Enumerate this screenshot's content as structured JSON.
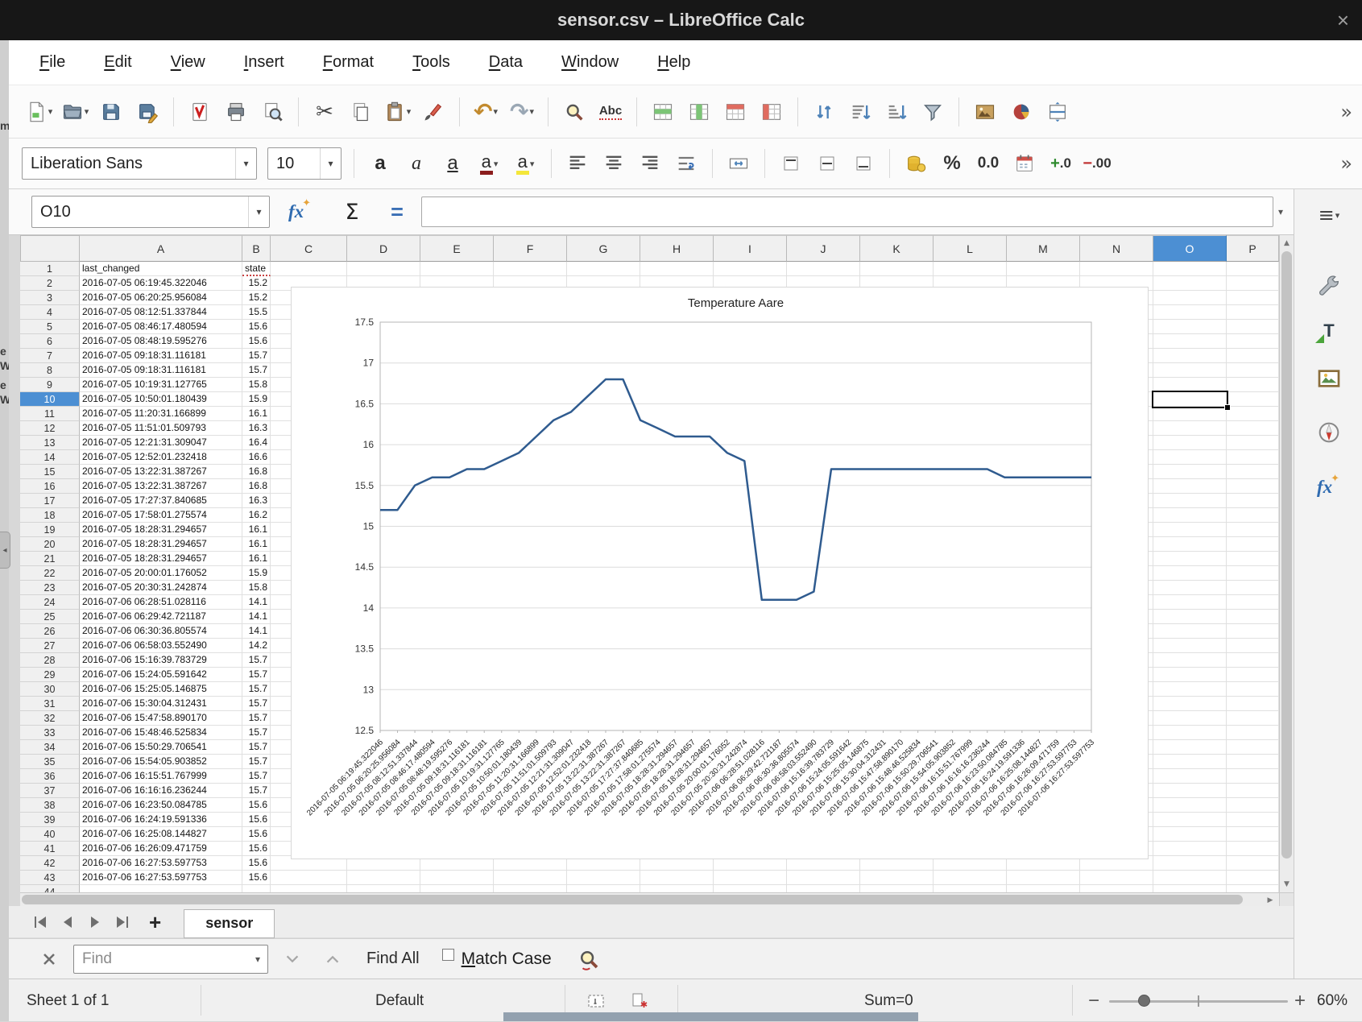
{
  "window": {
    "title": "sensor.csv – LibreOffice Calc",
    "close_glyph": "×"
  },
  "left_edge": {
    "letters": [
      "m",
      "e",
      "W",
      "e",
      "W"
    ]
  },
  "menubar": {
    "items": [
      "File",
      "Edit",
      "View",
      "Insert",
      "Format",
      "Tools",
      "Data",
      "Window",
      "Help"
    ]
  },
  "toolbars": {
    "overflow_glyph": "»",
    "font_name": "Liberation Sans",
    "font_size": "10",
    "standard_icon_names": [
      "new",
      "open",
      "save",
      "save-as",
      "export-pdf",
      "print",
      "print-preview",
      "cut",
      "copy",
      "paste",
      "clone-formatting",
      "undo",
      "redo",
      "find-and-replace",
      "spelling",
      "insert-row",
      "insert-column",
      "delete-row",
      "delete-column",
      "sort",
      "sort-ascending",
      "sort-descending",
      "autofilter",
      "insert-image",
      "insert-chart",
      "split-window"
    ],
    "formatting_icon_names": [
      "bold",
      "italic",
      "underline",
      "font-color",
      "highlighting-color",
      "align-left",
      "align-center",
      "align-right",
      "wrap-text",
      "merge-cells",
      "align-top",
      "center-vertically",
      "align-bottom",
      "currency",
      "percent",
      "number-format",
      "date-format",
      "add-decimal",
      "delete-decimal"
    ]
  },
  "icons": {
    "cut": "✂",
    "undo": "↶",
    "redo": "↷",
    "sum": "Σ",
    "equals": "=",
    "function_wizard": "fx",
    "star": "✦",
    "sidebar_menu": "≡",
    "styles_letter": "T",
    "spelling": "Abc",
    "bold": "a",
    "italic": "a",
    "underline": "a",
    "font_color": "a",
    "highlight": "a",
    "percent": "%",
    "number_format": "0.0",
    "add_decimal_sign": "+",
    "add_decimal_num": ".0",
    "del_decimal_sign": "−",
    "del_decimal_num": ".00",
    "add_sheet": "+"
  },
  "formula_bar": {
    "cell_reference": "O10",
    "input_value": ""
  },
  "grid": {
    "columns": [
      "A",
      "B",
      "C",
      "D",
      "E",
      "F",
      "G",
      "H",
      "I",
      "J",
      "K",
      "L",
      "M",
      "N",
      "O",
      "P"
    ],
    "selected_column": "O",
    "selected_row": 10,
    "selected_cell": "O10",
    "row_count": 44,
    "header_row": {
      "A": "last_changed",
      "B": "state"
    },
    "rows": [
      [
        "last_changed",
        "state"
      ],
      [
        "2016-07-05 06:19:45.322046",
        "15.2"
      ],
      [
        "2016-07-05 06:20:25.956084",
        "15.2"
      ],
      [
        "2016-07-05 08:12:51.337844",
        "15.5"
      ],
      [
        "2016-07-05 08:46:17.480594",
        "15.6"
      ],
      [
        "2016-07-05 08:48:19.595276",
        "15.6"
      ],
      [
        "2016-07-05 09:18:31.116181",
        "15.7"
      ],
      [
        "2016-07-05 09:18:31.116181",
        "15.7"
      ],
      [
        "2016-07-05 10:19:31.127765",
        "15.8"
      ],
      [
        "2016-07-05 10:50:01.180439",
        "15.9"
      ],
      [
        "2016-07-05 11:20:31.166899",
        "16.1"
      ],
      [
        "2016-07-05 11:51:01.509793",
        "16.3"
      ],
      [
        "2016-07-05 12:21:31.309047",
        "16.4"
      ],
      [
        "2016-07-05 12:52:01.232418",
        "16.6"
      ],
      [
        "2016-07-05 13:22:31.387267",
        "16.8"
      ],
      [
        "2016-07-05 13:22:31.387267",
        "16.8"
      ],
      [
        "2016-07-05 17:27:37.840685",
        "16.3"
      ],
      [
        "2016-07-05 17:58:01.275574",
        "16.2"
      ],
      [
        "2016-07-05 18:28:31.294657",
        "16.1"
      ],
      [
        "2016-07-05 18:28:31.294657",
        "16.1"
      ],
      [
        "2016-07-05 18:28:31.294657",
        "16.1"
      ],
      [
        "2016-07-05 20:00:01.176052",
        "15.9"
      ],
      [
        "2016-07-05 20:30:31.242874",
        "15.8"
      ],
      [
        "2016-07-06 06:28:51.028116",
        "14.1"
      ],
      [
        "2016-07-06 06:29:42.721187",
        "14.1"
      ],
      [
        "2016-07-06 06:30:36.805574",
        "14.1"
      ],
      [
        "2016-07-06 06:58:03.552490",
        "14.2"
      ],
      [
        "2016-07-06 15:16:39.783729",
        "15.7"
      ],
      [
        "2016-07-06 15:24:05.591642",
        "15.7"
      ],
      [
        "2016-07-06 15:25:05.146875",
        "15.7"
      ],
      [
        "2016-07-06 15:30:04.312431",
        "15.7"
      ],
      [
        "2016-07-06 15:47:58.890170",
        "15.7"
      ],
      [
        "2016-07-06 15:48:46.525834",
        "15.7"
      ],
      [
        "2016-07-06 15:50:29.706541",
        "15.7"
      ],
      [
        "2016-07-06 15:54:05.903852",
        "15.7"
      ],
      [
        "2016-07-06 16:15:51.767999",
        "15.7"
      ],
      [
        "2016-07-06 16:16:16.236244",
        "15.7"
      ],
      [
        "2016-07-06 16:23:50.084785",
        "15.6"
      ],
      [
        "2016-07-06 16:24:19.591336",
        "15.6"
      ],
      [
        "2016-07-06 16:25:08.144827",
        "15.6"
      ],
      [
        "2016-07-06 16:26:09.471759",
        "15.6"
      ],
      [
        "2016-07-06 16:27:53.597753",
        "15.6"
      ],
      [
        "2016-07-06 16:27:53.597753",
        "15.6"
      ]
    ]
  },
  "chart_data": {
    "type": "line",
    "title": "Temperature Aare",
    "xlabel": "",
    "ylabel": "",
    "legend": "none",
    "grid": "horizontal",
    "ylim": [
      12.5,
      17.5
    ],
    "yticks": [
      12.5,
      13,
      13.5,
      14,
      14.5,
      15,
      15.5,
      16,
      16.5,
      17,
      17.5
    ],
    "categories": [
      "2016-07-05 06:19:45.322046",
      "2016-07-05 06:20:25.956084",
      "2016-07-05 08:12:51.337844",
      "2016-07-05 08:46:17.480594",
      "2016-07-05 08:48:19.595276",
      "2016-07-05 09:18:31.116181",
      "2016-07-05 09:18:31.116181",
      "2016-07-05 10:19:31.127765",
      "2016-07-05 10:50:01.180439",
      "2016-07-05 11:20:31.166899",
      "2016-07-05 11:51:01.509793",
      "2016-07-05 12:21:31.309047",
      "2016-07-05 12:52:01.232418",
      "2016-07-05 13:22:31.387267",
      "2016-07-05 13:22:31.387267",
      "2016-07-05 17:27:37.840685",
      "2016-07-05 17:58:01.275574",
      "2016-07-05 18:28:31.294657",
      "2016-07-05 18:28:31.294657",
      "2016-07-05 18:28:31.294657",
      "2016-07-05 20:00:01.176052",
      "2016-07-05 20:30:31.242874",
      "2016-07-06 06:28:51.028116",
      "2016-07-06 06:29:42.721187",
      "2016-07-06 06:30:36.805574",
      "2016-07-06 06:58:03.552490",
      "2016-07-06 15:16:39.783729",
      "2016-07-06 15:24:05.591642",
      "2016-07-06 15:25:05.146875",
      "2016-07-06 15:30:04.312431",
      "2016-07-06 15:47:58.890170",
      "2016-07-06 15:48:46.525834",
      "2016-07-06 15:50:29.706541",
      "2016-07-06 15:54:05.903852",
      "2016-07-06 16:15:51.767999",
      "2016-07-06 16:16:16.236244",
      "2016-07-06 16:23:50.084785",
      "2016-07-06 16:24:19.591336",
      "2016-07-06 16:25:08.144827",
      "2016-07-06 16:26:09.471759",
      "2016-07-06 16:27:53.597753",
      "2016-07-06 16:27:53.597753"
    ],
    "series": [
      {
        "name": "state",
        "color": "#2f5b8f",
        "values": [
          15.2,
          15.2,
          15.5,
          15.6,
          15.6,
          15.7,
          15.7,
          15.8,
          15.9,
          16.1,
          16.3,
          16.4,
          16.6,
          16.8,
          16.8,
          16.3,
          16.2,
          16.1,
          16.1,
          16.1,
          15.9,
          15.8,
          14.1,
          14.1,
          14.1,
          14.2,
          15.7,
          15.7,
          15.7,
          15.7,
          15.7,
          15.7,
          15.7,
          15.7,
          15.7,
          15.7,
          15.6,
          15.6,
          15.6,
          15.6,
          15.6,
          15.6
        ]
      }
    ]
  },
  "sheet_bar": {
    "tabs": [
      {
        "label": "sensor",
        "active": true
      }
    ]
  },
  "find_bar": {
    "placeholder": "Find",
    "find_all_label": "Find All",
    "match_case_label": "Match Case"
  },
  "status_bar": {
    "sheet_info": "Sheet 1 of 1",
    "page_style": "Default",
    "sum_label": "Sum=0",
    "zoom_level": "60%"
  }
}
